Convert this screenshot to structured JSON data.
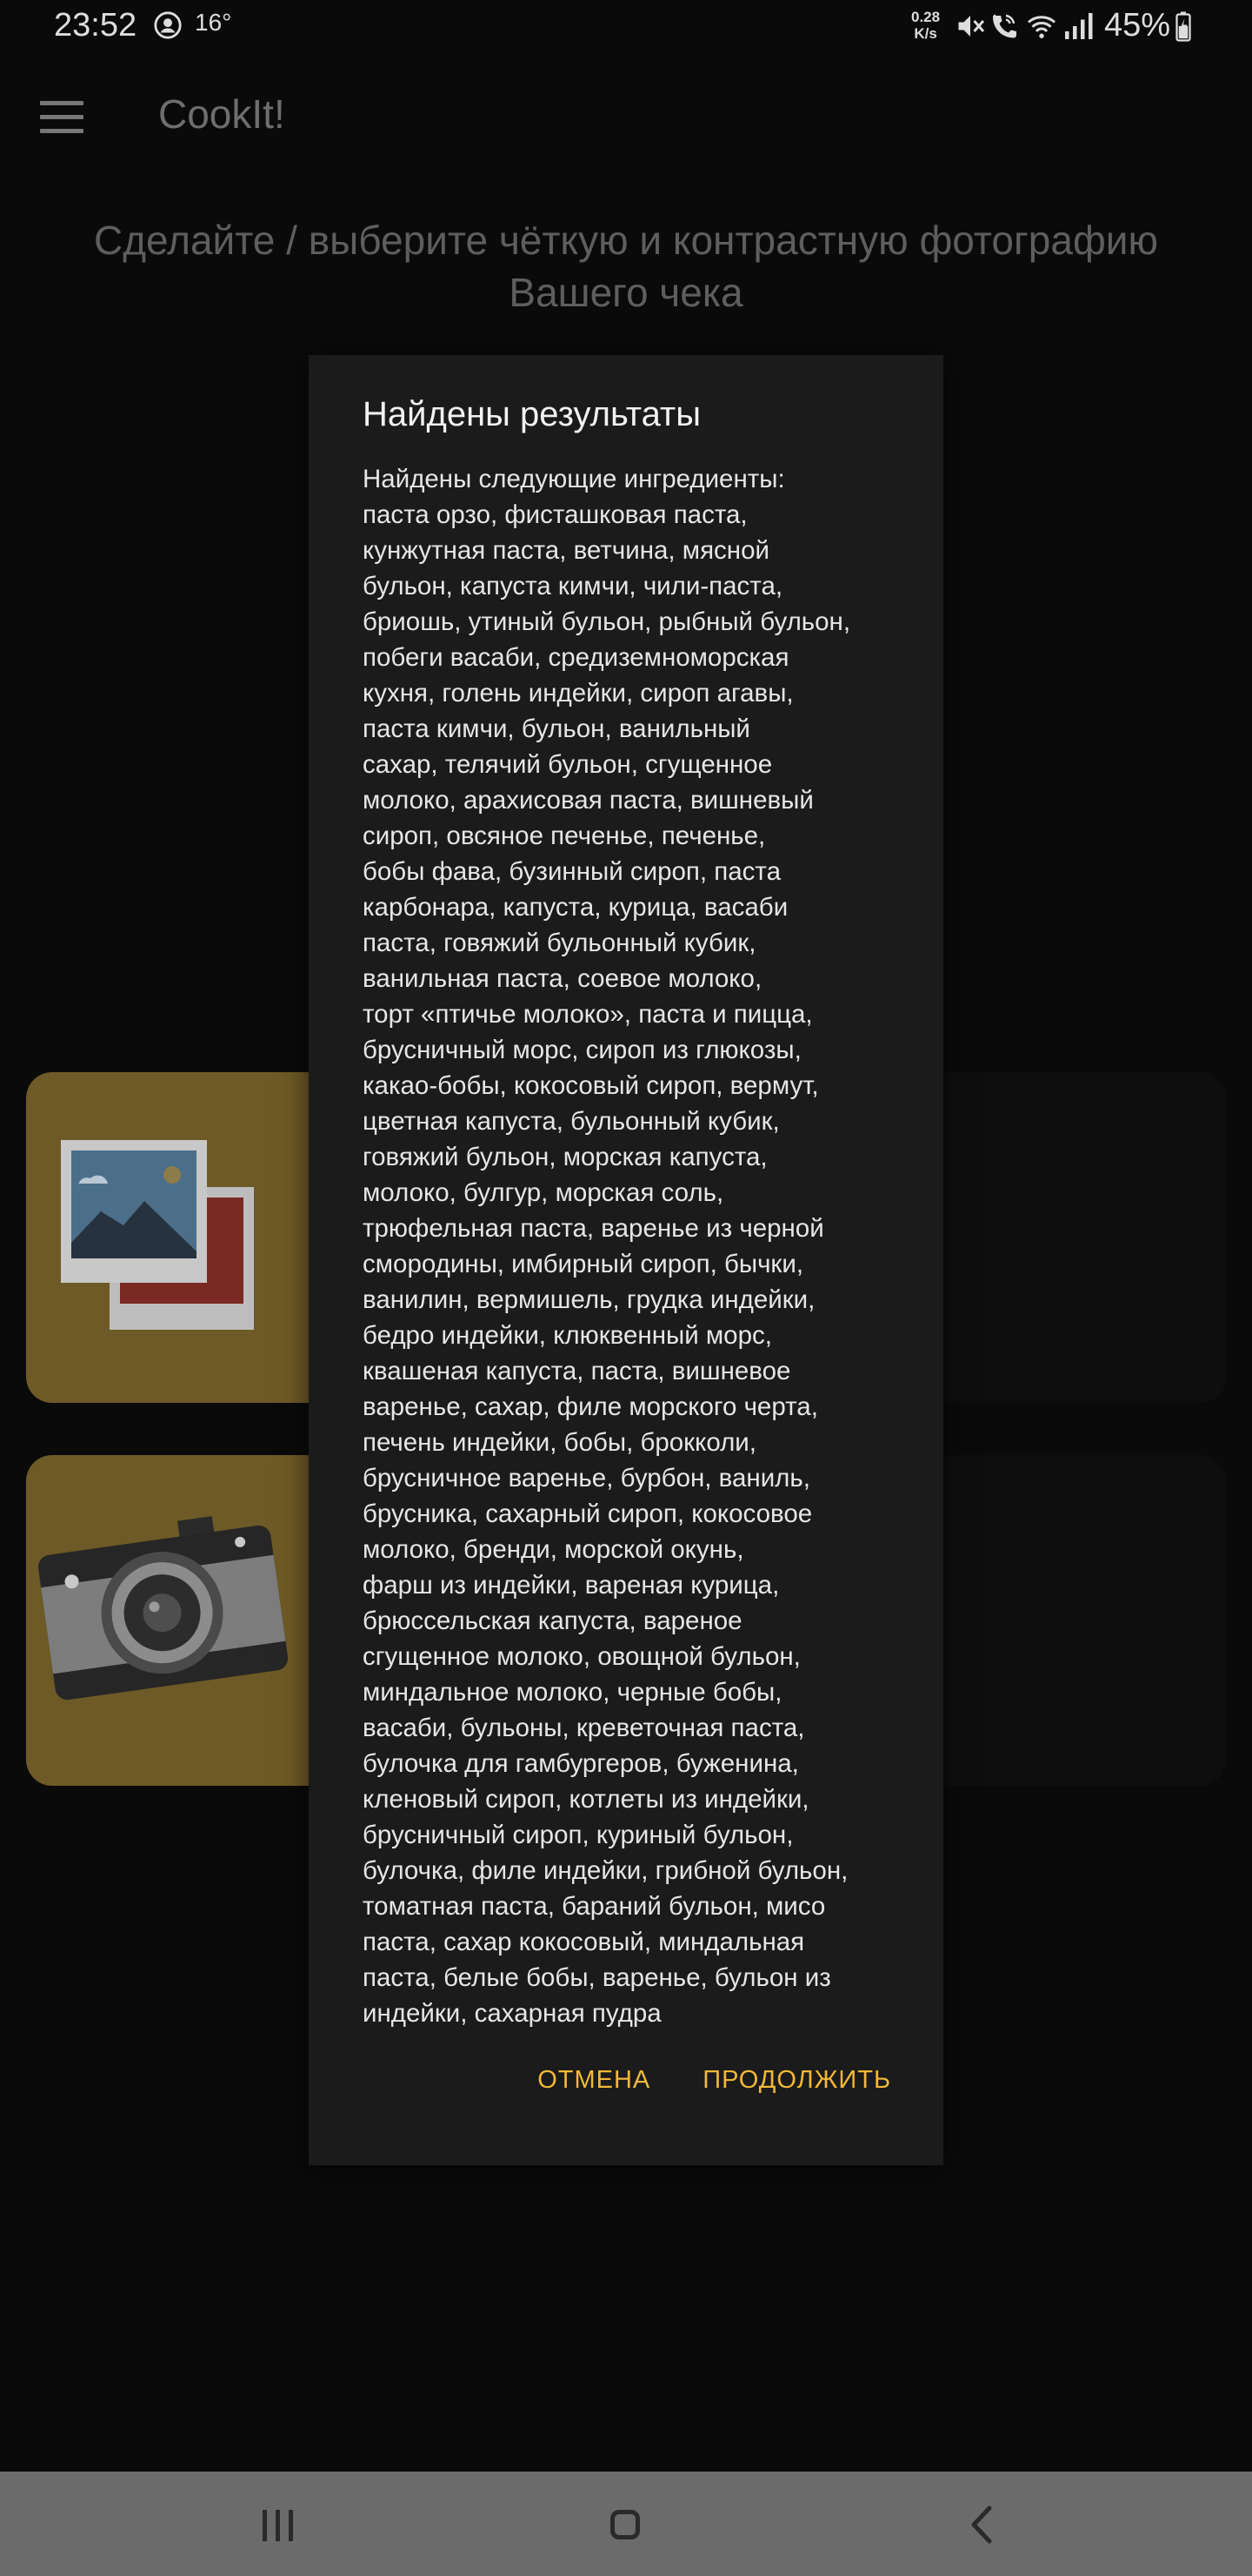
{
  "status_bar": {
    "time": "23:52",
    "temperature": "16°",
    "net_speed_value": "0.28",
    "net_speed_unit": "K/s",
    "battery": "45%",
    "icons": [
      "account-circle-icon",
      "mute-icon",
      "wifi-call-icon",
      "wifi-icon",
      "signal-icon",
      "battery-charging-icon"
    ]
  },
  "app_bar": {
    "menu_icon": "hamburger-menu-icon",
    "title": "CookIt!"
  },
  "main": {
    "instruction": "Сделайте / выберите чёткую и контрастную фотографию Вашего чека",
    "options": [
      {
        "id": "gallery",
        "icon": "gallery-photos-icon"
      },
      {
        "id": "camera",
        "icon": "camera-icon"
      }
    ]
  },
  "dialog": {
    "title": "Найдены результаты",
    "body": "Найдены следующие ингредиенты:\nпаста орзо, фисташковая паста,\nкунжутная паста, ветчина, мясной\nбульон, капуста кимчи, чили-паста,\nбриошь, утиный бульон, рыбный бульон,\nпобеги васаби, средиземноморская\nкухня, голень индейки, сироп агавы,\nпаста кимчи, бульон, ванильный\nсахар, телячий бульон, сгущенное\nмолоко, арахисовая паста, вишневый\nсироп, овсяное печенье, печенье,\nбобы фава, бузинный сироп, паста\nкарбонара, капуста, курица, васаби\nпаста, говяжий бульонный кубик,\nванильная паста, соевое молоко,\nторт «птичье молоко», паста и пицца,\nбрусничный морс, сироп из глюкозы,\nкакао-бобы, кокосовый сироп, вермут,\nцветная капуста, бульонный кубик,\nговяжий бульон, морская капуста,\nмолоко, булгур, морская соль,\nтрюфельная паста, варенье из черной\nсмородины, имбирный сироп, бычки,\nванилин, вермишель, грудка индейки,\nбедро индейки, клюквенный морс,\nквашеная капуста, паста, вишневое\nваренье, сахар, филе морского черта,\nпечень индейки, бобы, брокколи,\nбрусничное варенье, бурбон, ваниль,\nбрусника, сахарный сироп, кокосовое\nмолоко, бренди, морской окунь,\nфарш из индейки, вареная курица,\nбрюссельская капуста, вареное\nсгущенное молоко, овощной бульон,\nминдальное молоко, черные бобы,\nвасаби, бульоны, креветочная паста,\nбулочка для гамбургеров, буженина,\nкленовый сироп, котлеты из индейки,\nбрусничный сироп, куриный бульон,\nбулочка, филе индейки, грибной бульон,\nтоматная паста, бараний бульон, мисо\nпаста, сахар кокосовый, миндальная\nпаста, белые бобы, варенье, бульон из\nиндейки, сахарная пудра",
    "cancel_label": "ОТМЕНА",
    "continue_label": "ПРОДОЛЖИТЬ",
    "accent_color": "#f0b837"
  },
  "nav_bar": {
    "icons": [
      "recent-apps-icon",
      "home-icon",
      "back-icon"
    ]
  }
}
